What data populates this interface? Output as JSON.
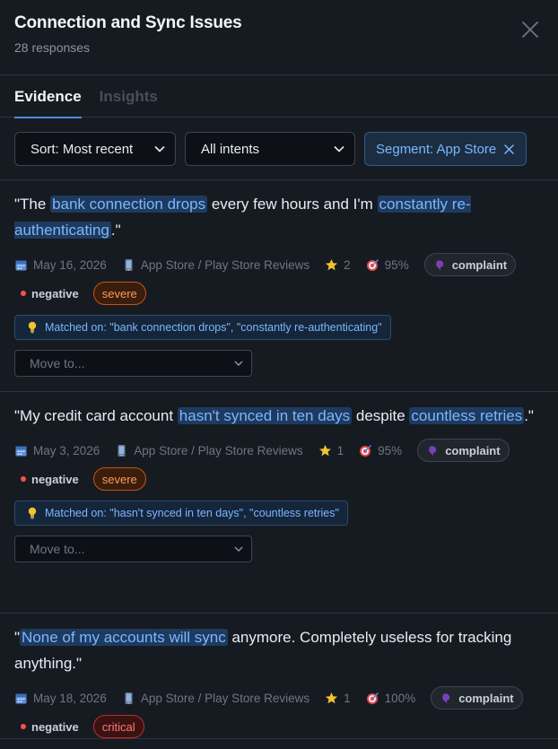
{
  "header": {
    "title": "Connection and Sync Issues",
    "subtitle": "28 responses"
  },
  "tabs": [
    {
      "label": "Evidence",
      "active": true
    },
    {
      "label": "Insights",
      "active": false
    }
  ],
  "filters": {
    "sort_label": "Sort: Most recent",
    "intent_label": "All intents",
    "segment_label": "Segment: App Store"
  },
  "cards": [
    {
      "quote_parts": [
        {
          "text": "\"The ",
          "hl": false
        },
        {
          "text": "bank connection drops",
          "hl": true
        },
        {
          "text": " every few hours and I'm ",
          "hl": false
        },
        {
          "text": "constantly re-authenticating",
          "hl": true
        },
        {
          "text": ".\"",
          "hl": false
        }
      ],
      "date": "May 16, 2026",
      "source": "App Store / Play Store Reviews",
      "rating": "2",
      "confidence": "95%",
      "intent": "complaint",
      "sentiment": "negative",
      "severity": "severe",
      "matched": "Matched on: \"bank connection drops\", \"constantly re-authenticating\"",
      "move_placeholder": "Move to..."
    },
    {
      "quote_parts": [
        {
          "text": "\"My credit card account ",
          "hl": false
        },
        {
          "text": "hasn't synced in ten days",
          "hl": true
        },
        {
          "text": " despite ",
          "hl": false
        },
        {
          "text": "countless retries",
          "hl": true
        },
        {
          "text": ".\"",
          "hl": false
        }
      ],
      "date": "May 3, 2026",
      "source": "App Store / Play Store Reviews",
      "rating": "1",
      "confidence": "95%",
      "intent": "complaint",
      "sentiment": "negative",
      "severity": "severe",
      "matched": "Matched on: \"hasn't synced in ten days\", \"countless retries\"",
      "move_placeholder": "Move to..."
    },
    {
      "quote_parts": [
        {
          "text": "\"",
          "hl": false
        },
        {
          "text": "None of my accounts will sync",
          "hl": true
        },
        {
          "text": " anymore. Completely useless for tracking anything.\"",
          "hl": false
        }
      ],
      "date": "May 18, 2026",
      "source": "App Store / Play Store Reviews",
      "rating": "1",
      "confidence": "100%",
      "intent": "complaint",
      "sentiment": "negative",
      "severity": "critical"
    }
  ],
  "colors": {
    "accent": "#4a90d9",
    "highlight_bg": "#1f3a5f",
    "highlight_text": "#79b8ff",
    "negative_dot": "#f85149",
    "severe": "#ff9a5a",
    "critical": "#ff7b72"
  },
  "icons": {
    "close": "close-icon",
    "calendar": "calendar-icon",
    "source": "phone-icon",
    "rating": "star-icon",
    "confidence": "target-icon",
    "intent": "speech-icon",
    "matched": "lightbulb-icon"
  }
}
